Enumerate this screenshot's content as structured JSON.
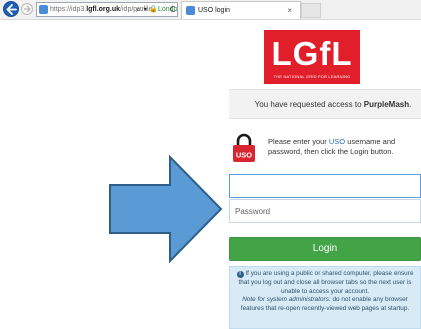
{
  "browser": {
    "url_prefix": "https://idp3.",
    "url_host": "lgfl.org.uk",
    "url_path": "/idp/profile",
    "search_glyph": "⌕ ▾",
    "site_identity": "London Grid ...",
    "tab_title": "USO login",
    "tab_close": "×",
    "icons": [
      "back-arrow-icon",
      "forward-arrow-icon",
      "site-favicon",
      "search-icon",
      "lock-icon",
      "refresh-icon",
      "close-icon"
    ]
  },
  "logo": {
    "text": "LGfL",
    "tagline": "THE NATIONAL GRID FOR LEARNING"
  },
  "access": {
    "prefix": "You have requested access to ",
    "service": "PurpleMash",
    "suffix": "."
  },
  "notice": {
    "icon_text": "USO",
    "text_before": "Please enter your ",
    "link": "USO",
    "text_after": " username and password, then click the Login button."
  },
  "form": {
    "username_value": "",
    "username_placeholder": "",
    "password_placeholder": "Password",
    "login_label": "Login"
  },
  "info": {
    "icon": "i",
    "line1": " If you are using a public or shared computer, please ensure that you log out and close all browser tabs so the next user is unable to access your account.",
    "line2": "Note for system administrators:",
    "line3": " do not enable any browser features that re-open recently-viewed web pages at startup."
  },
  "colors": {
    "brand_red": "#e11f2a",
    "login_green": "#42a447",
    "info_bg": "#d8eaf6",
    "arrow_blue": "#5b9bd5",
    "link_blue": "#2a6ebb"
  }
}
